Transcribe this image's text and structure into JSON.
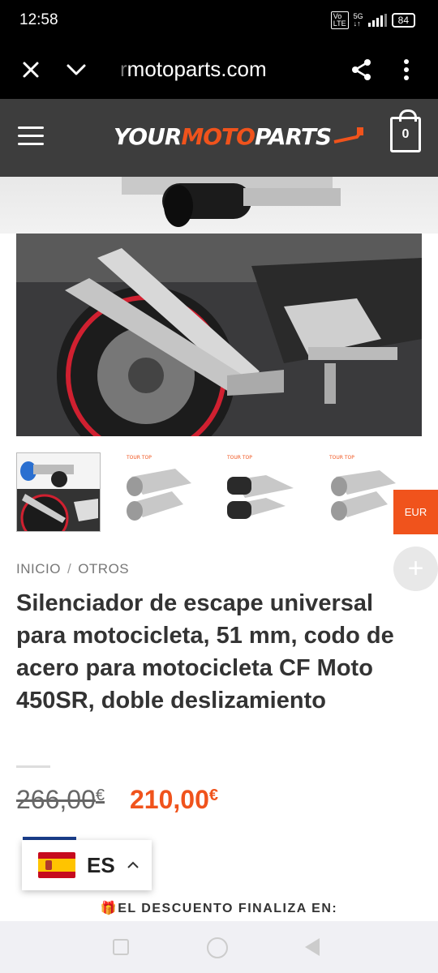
{
  "status_bar": {
    "time": "12:58",
    "volte_label": "Vo\nLTE",
    "network": "5G",
    "battery": "84"
  },
  "browser": {
    "url_prefix": "r",
    "url": "motoparts.com",
    "close_icon": "close-icon",
    "chevron_icon": "chevron-down-icon",
    "share_icon": "share-icon",
    "menu_icon": "more-vert-icon"
  },
  "header": {
    "logo_white_1": "YOUR",
    "logo_orange": "MOTO",
    "logo_white_2": "PARTS",
    "cart_count": "0",
    "brand_color": "#f0531c"
  },
  "gallery": {
    "thumbnails": [
      "thumb-1",
      "thumb-2",
      "thumb-3",
      "thumb-4"
    ],
    "active_index": 0,
    "thumb_brand_text": "TOUR TOP"
  },
  "currency_badge": "EUR",
  "add_button": "+",
  "breadcrumb": {
    "home": "INICIO",
    "separator": "/",
    "category": "OTROS"
  },
  "product": {
    "title": "Silenciador de escape universal para motocicleta, 51 mm, codo de acero para motocicleta CF Moto 450SR, doble deslizamiento",
    "price_old": "266,00",
    "price_new": "210,00",
    "currency_symbol": "€"
  },
  "language_selector": {
    "code": "ES",
    "chevron": "^"
  },
  "countdown_text": "🎁EL DESCUENTO FINALIZA EN:"
}
